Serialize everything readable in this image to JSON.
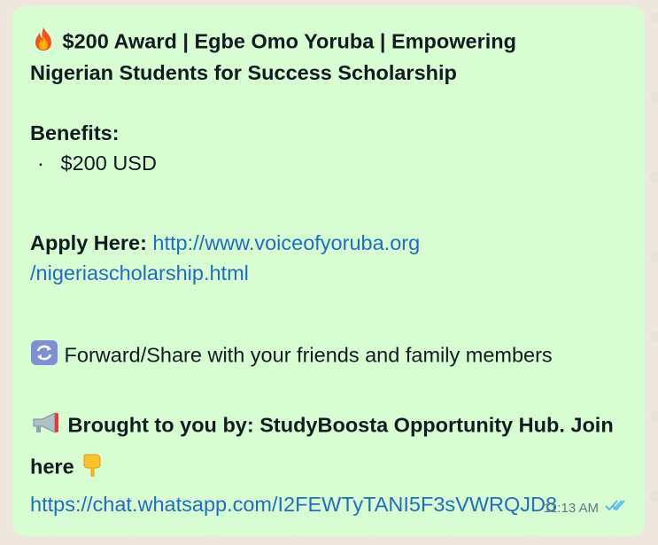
{
  "message": {
    "title_line1": "$200 Award | Egbe Omo Yoruba |  Empowering",
    "title_line2": "Nigerian Students for Success Scholarship",
    "benefits_heading": "Benefits:",
    "benefit_items": [
      "$200 USD"
    ],
    "apply_label": "Apply Here:",
    "apply_link_part1": "http://www.voiceofyoruba.org",
    "apply_link_part2": "/nigeriascholarship.html",
    "forward_text": "Forward/Share with your friends and family members",
    "brought_line1": "Brought to you by: StudyBoosta Opportunity Hub. Join",
    "brought_line2": "here",
    "join_link": "https://chat.whatsapp.com/I2FEWTyTANI5F3sVWRQJD8",
    "timestamp": "11:13 AM",
    "read_status": "read"
  },
  "icons": {
    "title": "fire-icon",
    "forward": "repeat-arrows-icon",
    "brought": "megaphone-icon",
    "here": "pointing-down-icon",
    "status": "double-check-icon"
  },
  "colors": {
    "bubble": "#d9fdd3",
    "link": "#1f6fbf",
    "read_ticks": "#53bdeb",
    "timestamp": "#667781"
  }
}
